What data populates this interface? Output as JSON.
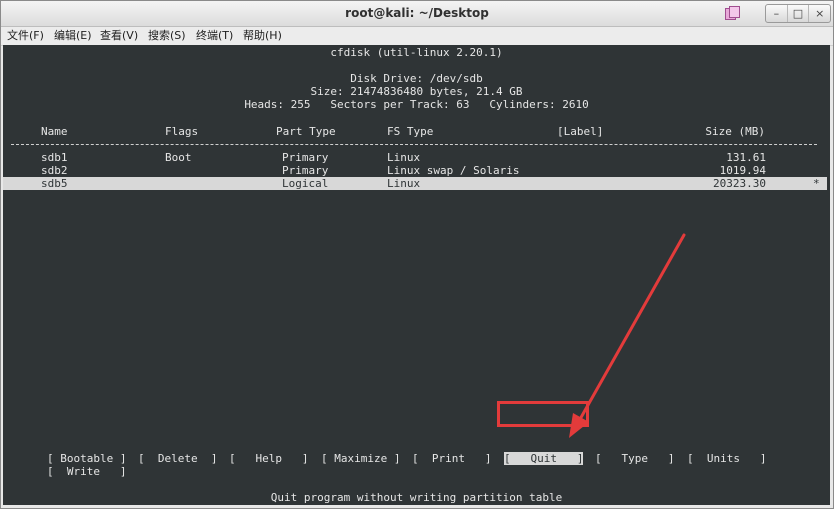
{
  "window": {
    "title": "root@kali: ~/Desktop",
    "controls": [
      "–",
      "□",
      "×"
    ]
  },
  "menubar": [
    "文件(F)",
    "编辑(E)",
    "查看(V)",
    "搜索(S)",
    "终端(T)",
    "帮助(H)"
  ],
  "terminal": {
    "program": "cfdisk (util-linux 2.20.1)",
    "disk_line": "Disk Drive: /dev/sdb",
    "size_line": "Size: 21474836480 bytes, 21.4 GB",
    "geometry_line": "Heads: 255   Sectors per Track: 63   Cylinders: 2610",
    "columns": {
      "name": "Name",
      "flags": "Flags",
      "part_type": "Part Type",
      "fs_type": "FS Type",
      "label": "[Label]",
      "size": "Size (MB)"
    },
    "partitions": [
      {
        "name": "sdb1",
        "flags": "Boot",
        "part_type": "Primary",
        "fs_type": "Linux",
        "label": "",
        "size": "131.61",
        "marker": ""
      },
      {
        "name": "sdb2",
        "flags": "",
        "part_type": "Primary",
        "fs_type": "Linux swap / Solaris",
        "label": "",
        "size": "1019.94",
        "marker": ""
      },
      {
        "name": "sdb5",
        "flags": "",
        "part_type": "Logical",
        "fs_type": "Linux",
        "label": "",
        "size": "20323.30",
        "marker": "*"
      }
    ],
    "selected_partition": "sdb5",
    "actions": [
      {
        "label": "[ Bootable ]"
      },
      {
        "label": "[  Delete  ]"
      },
      {
        "label": "[   Help   ]"
      },
      {
        "label": "[ Maximize ]"
      },
      {
        "label": "[  Print   ]"
      },
      {
        "label": "[   Quit   ]"
      },
      {
        "label": "[   Type   ]"
      },
      {
        "label": "[  Units   ]"
      },
      {
        "label": "[  Write   ]"
      }
    ],
    "active_action": "Quit",
    "hint": "Quit program without writing partition table"
  },
  "colors": {
    "terminal_bg": "#2f3436",
    "terminal_fg": "#e6e6e6",
    "highlight_box": "#e33b3b"
  }
}
